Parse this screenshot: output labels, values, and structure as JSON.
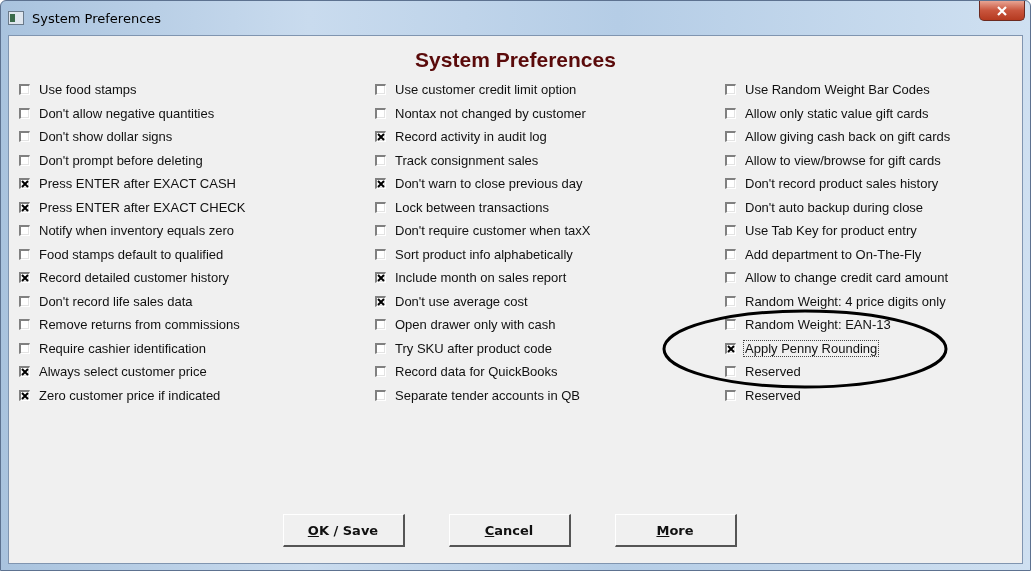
{
  "window": {
    "title": "System Preferences"
  },
  "heading": "System Preferences",
  "columns": [
    [
      {
        "label": "Use food stamps",
        "checked": false
      },
      {
        "label": "Don't allow negative quantities",
        "checked": false
      },
      {
        "label": "Don't show dollar signs",
        "checked": false
      },
      {
        "label": "Don't prompt before deleting",
        "checked": false
      },
      {
        "label": "Press ENTER after EXACT CASH",
        "checked": true
      },
      {
        "label": "Press ENTER after EXACT CHECK",
        "checked": true
      },
      {
        "label": "Notify when inventory equals zero",
        "checked": false
      },
      {
        "label": "Food stamps default to qualified",
        "checked": false
      },
      {
        "label": "Record detailed customer history",
        "checked": true
      },
      {
        "label": "Don't record life sales data",
        "checked": false
      },
      {
        "label": "Remove returns from commissions",
        "checked": false
      },
      {
        "label": "Require cashier identification",
        "checked": false
      },
      {
        "label": "Always select customer price",
        "checked": true
      },
      {
        "label": "Zero customer price if indicated",
        "checked": true
      }
    ],
    [
      {
        "label": "Use customer credit limit option",
        "checked": false
      },
      {
        "label": "Nontax not changed by customer",
        "checked": false
      },
      {
        "label": "Record activity in audit log",
        "checked": true
      },
      {
        "label": "Track consignment sales",
        "checked": false
      },
      {
        "label": "Don't warn to close previous day",
        "checked": true
      },
      {
        "label": "Lock between transactions",
        "checked": false
      },
      {
        "label": "Don't require customer when taxX",
        "checked": false
      },
      {
        "label": "Sort product info alphabetically",
        "checked": false
      },
      {
        "label": "Include month on sales report",
        "checked": true
      },
      {
        "label": "Don't use average cost",
        "checked": true
      },
      {
        "label": "Open drawer only with cash",
        "checked": false
      },
      {
        "label": "Try SKU after product code",
        "checked": false
      },
      {
        "label": "Record data for QuickBooks",
        "checked": false
      },
      {
        "label": "Separate tender accounts in QB",
        "checked": false
      }
    ],
    [
      {
        "label": "Use Random Weight Bar Codes",
        "checked": false
      },
      {
        "label": "Allow only static value gift cards",
        "checked": false
      },
      {
        "label": "Allow giving cash back on gift cards",
        "checked": false
      },
      {
        "label": "Allow to view/browse for gift cards",
        "checked": false
      },
      {
        "label": "Don't record product sales history",
        "checked": false
      },
      {
        "label": "Don't auto backup during close",
        "checked": false
      },
      {
        "label": "Use Tab Key for product entry",
        "checked": false
      },
      {
        "label": "Add department to On-The-Fly",
        "checked": false
      },
      {
        "label": "Allow to change credit card amount",
        "checked": false
      },
      {
        "label": "Random Weight: 4 price digits only",
        "checked": false
      },
      {
        "label": "Random Weight: EAN-13",
        "checked": false
      },
      {
        "label": "Apply Penny Rounding",
        "checked": true,
        "circled": true
      },
      {
        "label": "Reserved",
        "checked": false
      },
      {
        "label": "Reserved",
        "checked": false
      }
    ]
  ],
  "buttons": [
    {
      "mnemonic": "O",
      "rest": "K / Save"
    },
    {
      "mnemonic": "C",
      "rest": "ancel"
    },
    {
      "mnemonic": "M",
      "rest": "ore"
    }
  ]
}
